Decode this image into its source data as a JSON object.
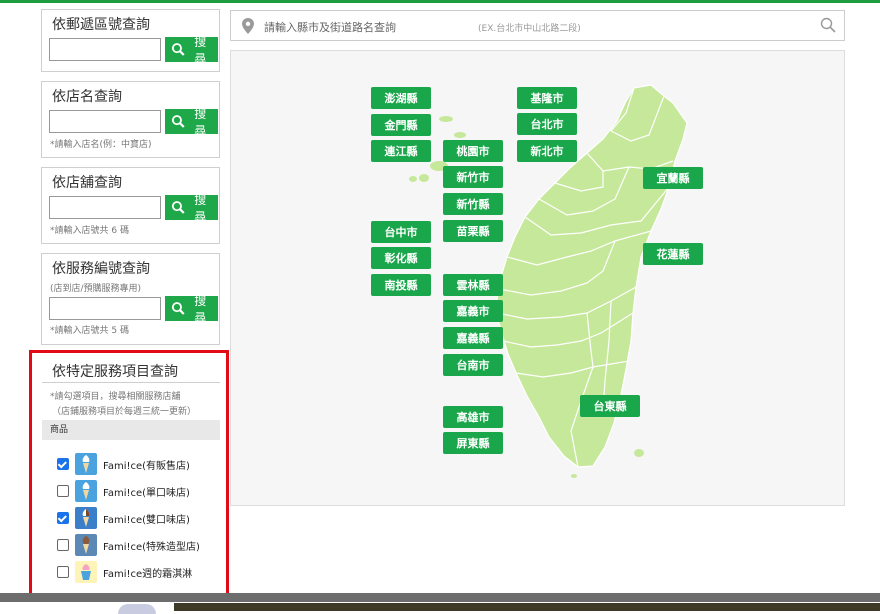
{
  "search_panels": [
    {
      "title": "依郵遞區號查詢",
      "input_value": "",
      "button_label": "搜尋",
      "note": ""
    },
    {
      "title": "依店名查詢",
      "input_value": "",
      "button_label": "搜尋",
      "note": "*請輸入店名(例：中寶店)"
    },
    {
      "title": "依店舖查詢",
      "input_value": "",
      "button_label": "搜尋",
      "note": "*請輸入店號共 6 碼"
    },
    {
      "title": "依服務編號查詢",
      "subtitle": "(店到店/預購服務專用)",
      "input_value": "",
      "button_label": "搜尋",
      "note": "*請輸入店號共 5 碼"
    }
  ],
  "special_service": {
    "title": "依特定服務項目查詢",
    "note_line1": "*請勾選項目，搜尋相關服務店舖",
    "note_line2": "（店鋪服務項目於每週三統一更新）",
    "category": "商品",
    "items": [
      {
        "label": "Fami!ce(有販售店)",
        "checked": true,
        "icon": "soft-serve-icon"
      },
      {
        "label": "Fami!ce(單口味店)",
        "checked": false,
        "icon": "soft-serve-icon"
      },
      {
        "label": "Fami!ce(雙口味店)",
        "checked": true,
        "icon": "twist-soft-serve-icon"
      },
      {
        "label": "Fami!ce(特殊造型店)",
        "checked": false,
        "icon": "special-soft-serve-icon"
      },
      {
        "label": "Fami!ce週的霜淇淋",
        "checked": false,
        "icon": "sundae-cup-icon"
      }
    ]
  },
  "address_search": {
    "placeholder": "請輸入縣市及街道路名查詢",
    "example": "(EX.台北市中山北路二段)"
  },
  "regions": {
    "penghu": "澎湖縣",
    "kinmen": "金門縣",
    "lienchiang": "連江縣",
    "keelung": "基隆市",
    "taipei": "台北市",
    "new_taipei": "新北市",
    "taoyuan": "桃園市",
    "hsinchu_city": "新竹市",
    "hsinchu_county": "新竹縣",
    "miaoli": "苗栗縣",
    "yilan": "宜蘭縣",
    "taichung": "台中市",
    "changhua": "彰化縣",
    "nantou": "南投縣",
    "hualien": "花蓮縣",
    "yunlin": "雲林縣",
    "chiayi_city": "嘉義市",
    "chiayi_county": "嘉義縣",
    "tainan": "台南市",
    "taitung": "台東縣",
    "kaohsiung": "高雄市",
    "pingtung": "屏東縣"
  },
  "colors": {
    "brand_green": "#1aa64a",
    "map_land": "#c6e89a",
    "highlight_red": "#e20a14"
  }
}
